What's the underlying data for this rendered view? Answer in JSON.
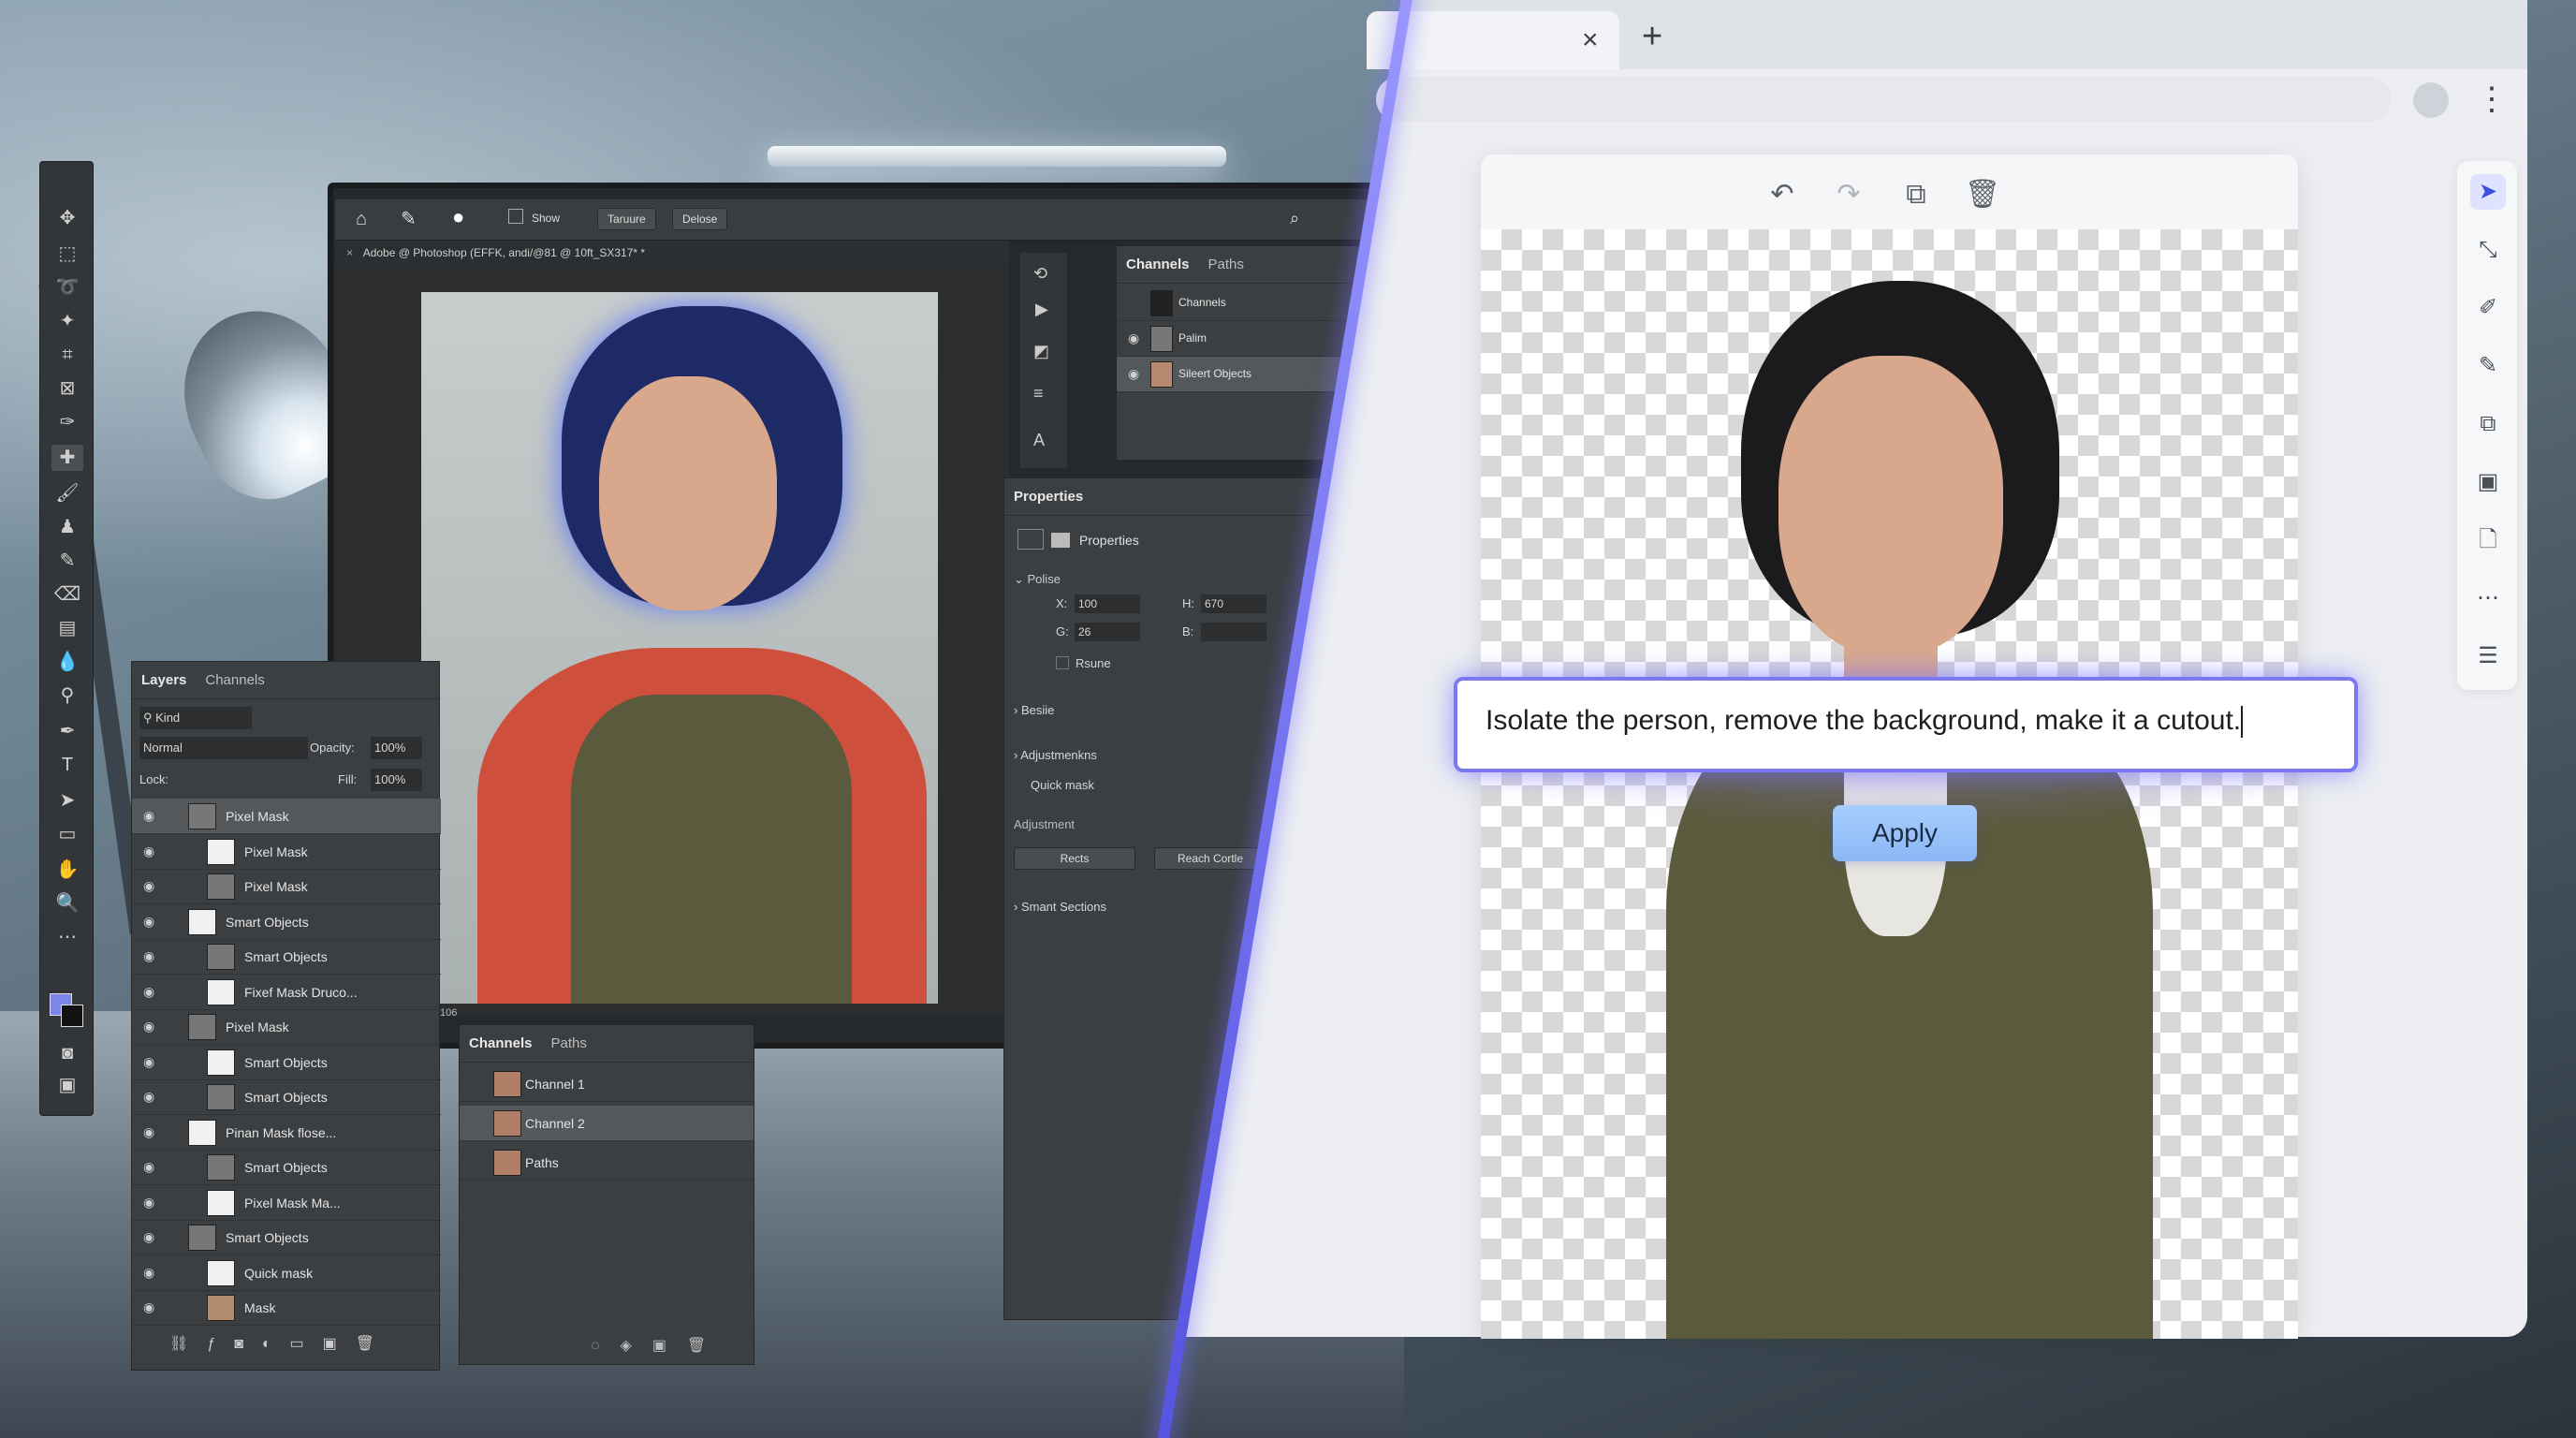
{
  "photoshop": {
    "toolbar_show": "Show",
    "toolbar_texture": "Taruure",
    "toolbar_delete": "Delose",
    "doc_tab": "Adobe @ Photoshop (EFFK, andi/@81 @ 10ft_SX317* *",
    "right_tabs": [
      "Channels",
      "Paths"
    ],
    "right_channels_rows": [
      "Channels",
      "Palim",
      "Sileert Objects"
    ],
    "properties": {
      "title": "Properties",
      "subtitle": "Properties",
      "section": "Polise",
      "x_label": "X:",
      "x_value": "100",
      "h_label": "H:",
      "h_value": "670",
      "g_label": "G:",
      "g_value": "26",
      "b_label": "B:",
      "b_value": "",
      "rsune": "Rsune",
      "besiie": "Besiie",
      "adjustments": "Adjustmenkns",
      "quick_mask": "Quick mask",
      "adjustment": "Adjustment",
      "rects_button": "Rects",
      "reach_button": "Reach Cortle",
      "smart_sections": "Smant Sections"
    },
    "layers": {
      "tabs": [
        "Layers",
        "Channels"
      ],
      "kind": "Kind",
      "blend": "Normal",
      "opacity_label": "Opacity:",
      "opacity_value": "100%",
      "lock_label": "Lock:",
      "fill_label": "Fill:",
      "fill_value": "100%",
      "rows": [
        "Pixel Mask",
        "Pixel Mask",
        "Pixel Mask",
        "Smart Objects",
        "Smart Objects",
        "Fixef Mask Druco...",
        "Pixel Mask",
        "Smart Objects",
        "Smart Objects",
        "Pinan Mask flose...",
        "Smart Objects",
        "Pixel Mask Ma...",
        "Smart Objects",
        "Quick mask",
        "Mask"
      ]
    },
    "channels": {
      "tabs": [
        "Channels",
        "Paths"
      ],
      "tiny_label": "106",
      "rows": [
        "Channel 1",
        "Channel 2",
        "Paths"
      ]
    }
  },
  "browser": {
    "close_tab": "×",
    "new_tab": "+",
    "menu": "⋮"
  },
  "editor": {
    "prompt": "Isolate the person, remove the background, make it a cutout.",
    "apply_label": "Apply"
  },
  "colors": {
    "accent": "#7b79f2",
    "apply": "#a7cdfb",
    "ps_panel": "#3c3f42"
  }
}
